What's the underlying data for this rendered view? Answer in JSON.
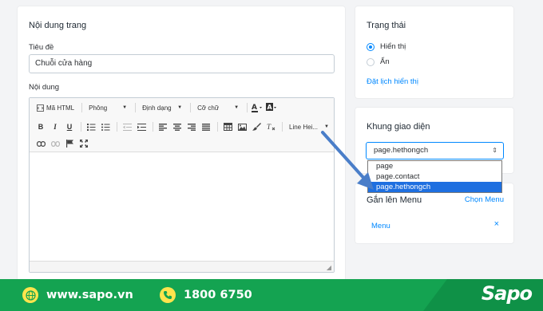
{
  "main": {
    "title": "Nội dung trang",
    "title_label": "Tiêu đề",
    "title_value": "Chuỗi cửa hàng",
    "content_label": "Nội dung",
    "toolbar": {
      "source_label": "Mã HTML",
      "font_dd": "Phông",
      "format_dd": "Định dạng",
      "size_dd": "Cỡ chữ",
      "lineheight_dd": "Line Hei..."
    }
  },
  "status": {
    "title": "Trạng thái",
    "options": [
      "Hiển thị",
      "Ẩn"
    ],
    "selected": "Hiển thị",
    "schedule_link": "Đặt lịch hiển thị"
  },
  "template": {
    "title": "Khung giao diện",
    "selected": "page.hethongch",
    "options": [
      "page",
      "page.contact",
      "page.hethongch"
    ]
  },
  "menu": {
    "title": "Gắn lên Menu",
    "choose_link": "Chọn Menu",
    "item": "Menu",
    "remove_symbol": "×"
  },
  "footer": {
    "website": "www.sapo.vn",
    "phone": "1800 6750",
    "logo": "Sapo"
  },
  "colors": {
    "accent": "#0088ff",
    "footer_green": "#14a351",
    "arrow": "#4a7ec9",
    "selected_option": "#1e6fe0",
    "footer_icon": "#ffe44d"
  }
}
